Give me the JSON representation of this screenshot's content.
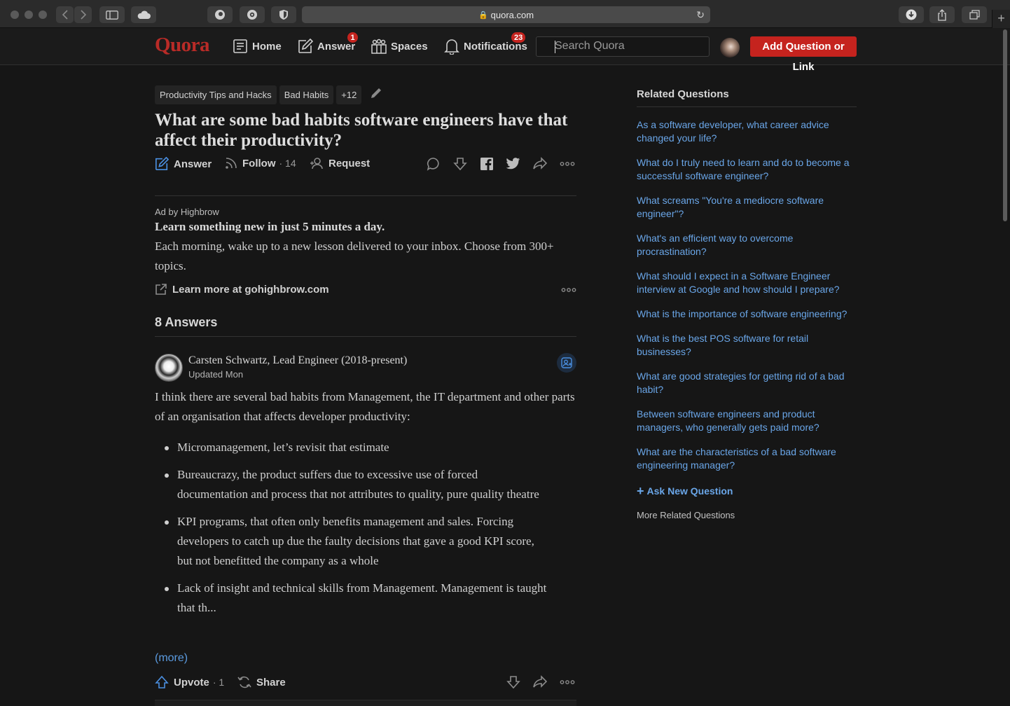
{
  "browser": {
    "url": "quora.com"
  },
  "header": {
    "logo": "Quora",
    "nav": [
      {
        "label": "Home",
        "icon": "home-icon"
      },
      {
        "label": "Answer",
        "icon": "answer-pen-icon",
        "badge": "1"
      },
      {
        "label": "Spaces",
        "icon": "spaces-icon"
      },
      {
        "label": "Notifications",
        "icon": "bell-icon",
        "badge": "23"
      }
    ],
    "search_placeholder": "Search Quora",
    "add_button": "Add Question or Link"
  },
  "question": {
    "topics": [
      "Productivity Tips and Hacks",
      "Bad Habits",
      "+12"
    ],
    "title": "What are some bad habits software engineers have that affect their productivity?",
    "actions": {
      "answer": "Answer",
      "follow": "Follow",
      "follow_count": "· 14",
      "request": "Request"
    }
  },
  "ad": {
    "by": "Ad by Highbrow",
    "title": "Learn something new in just 5 minutes a day.",
    "body": "Each morning, wake up to a new lesson delivered to your inbox. Choose from 300+ topics.",
    "link": "Learn more at gohighbrow.com"
  },
  "answers": {
    "count_label": "8 Answers",
    "first": {
      "author": "Carsten Schwartz, Lead Engineer (2018-present)",
      "date": "Updated Mon",
      "intro": "I think there are several bad habits from Management, the IT department and other parts of an organisation that affects developer productivity:",
      "bullets": [
        "Micromanagement, let’s revisit that estimate",
        "Bureaucrazy, the product suffers due to excessive use of forced documentation and process that not attributes to quality, pure quality theatre",
        "KPI programs, that often only benefits management and sales. Forcing developers to catch up due the faulty decisions that gave a good KPI score, but not benefitted the company as a whole",
        "Lack of insight and technical skills from Management. Management is taught that th..."
      ],
      "more": "(more)",
      "upvote": "Upvote",
      "upvote_count": "· 1",
      "share": "Share"
    }
  },
  "sidebar": {
    "title": "Related Questions",
    "questions": [
      "As a software developer, what career advice changed your life?",
      "What do I truly need to learn and do to become a successful software engineer?",
      "What screams \"You're a mediocre software engineer\"?",
      "What's an efficient way to overcome procrastination?",
      "What should I expect in a Software Engineer interview at Google and how should I prepare?",
      "What is the importance of software engineering?",
      "What is the best POS software for retail businesses?",
      "What are good strategies for getting rid of a bad habit?",
      "Between software engineers and product managers, who generally gets paid more?",
      "What are the characteristics of a bad software engineering manager?"
    ],
    "ask_new": "Ask New Question",
    "more_related": "More Related Questions"
  },
  "colors": {
    "brand": "#b92b27",
    "link": "#6aa6e8",
    "background": "#161616"
  }
}
